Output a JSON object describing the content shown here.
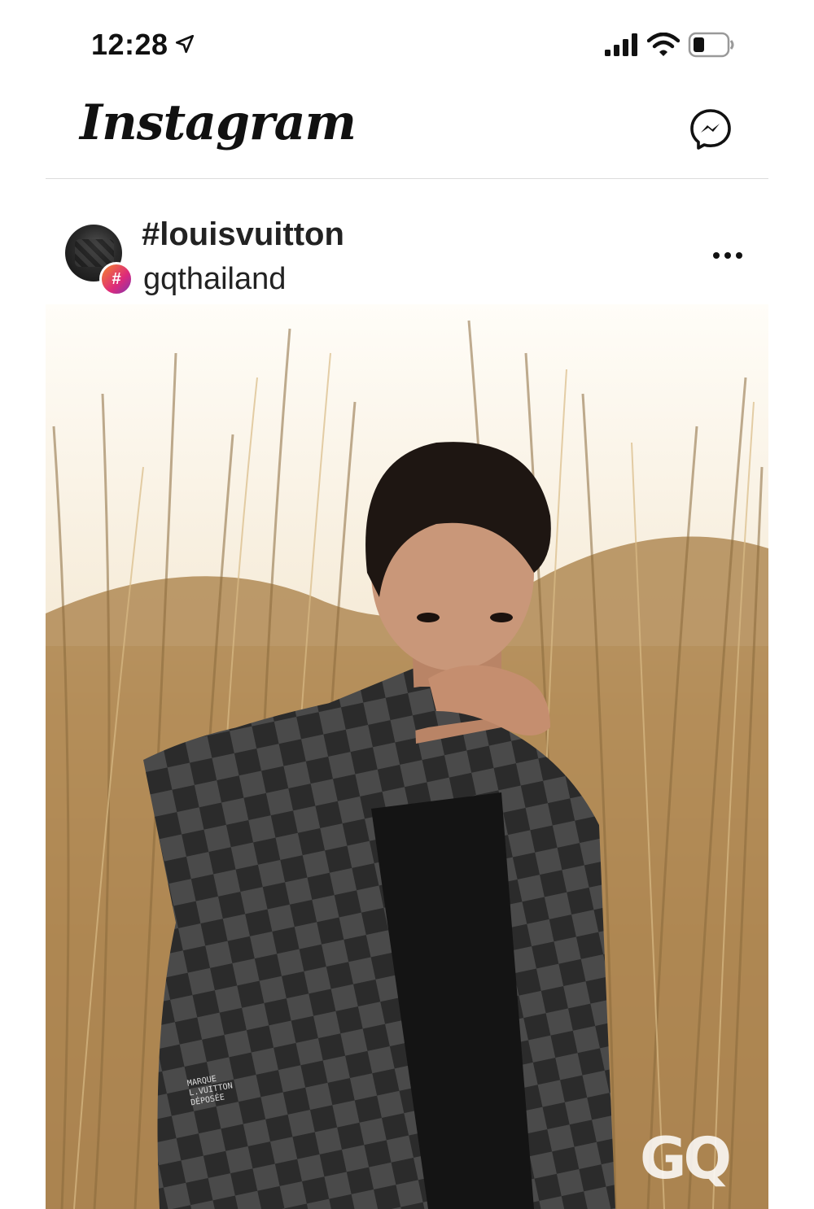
{
  "status_bar": {
    "time": "12:28",
    "icons": [
      "location-arrow-icon",
      "cellular-signal-icon",
      "wifi-icon",
      "battery-icon"
    ]
  },
  "header": {
    "logo_text": "Instagram",
    "messenger_icon": "messenger-icon"
  },
  "post": {
    "hashtag": "#louisvuitton",
    "username": "gqthailand",
    "badge_symbol": "#",
    "more_icon": "more-options-icon",
    "image_alt": "fashion photo",
    "watermark": "GQ",
    "jacket_label": [
      "MARQUE",
      "L.VUITTON",
      "DÉPOSÉE"
    ]
  },
  "colors": {
    "text": "#111111",
    "divider": "#dcdcdc",
    "badge_gradient": [
      "#f58529",
      "#dd2a7b",
      "#8134af"
    ]
  }
}
